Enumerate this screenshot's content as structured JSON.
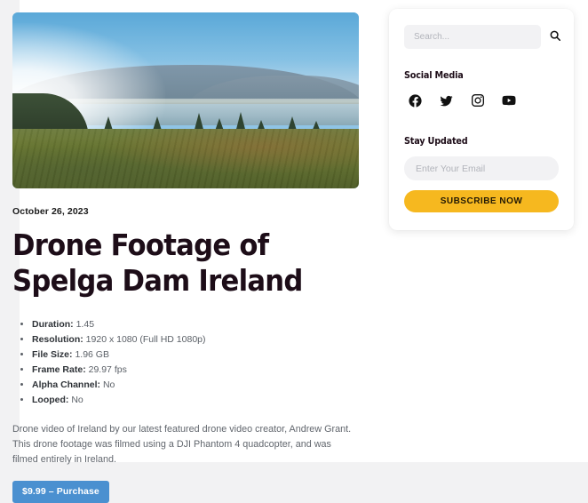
{
  "theme": {
    "page_background": "#f2f2f3",
    "card_background": "#ffffff",
    "accent_gold": "#f6b81f",
    "accent_blue": "#4a90d0",
    "heading_color": "#1d0d18",
    "body_text_color": "#61666d"
  },
  "post": {
    "hero_image_alt": "Aerial landscape of Spelga Dam, Ireland with mountain ridge, lake and grassy foreground",
    "date": "October 26, 2023",
    "title": "Drone Footage of Spelga Dam Ireland",
    "metadata": [
      {
        "label": "Duration:",
        "value": "1.45"
      },
      {
        "label": "Resolution:",
        "value": "1920 x 1080 (Full HD 1080p)"
      },
      {
        "label": "File Size:",
        "value": "1.96 GB"
      },
      {
        "label": "Frame Rate:",
        "value": "29.97 fps"
      },
      {
        "label": "Alpha Channel:",
        "value": "No"
      },
      {
        "label": "Looped:",
        "value": "No"
      }
    ],
    "description": "Drone video of Ireland by our latest featured drone video creator, Andrew Grant. This drone footage was filmed using a DJI Phantom 4 quadcopter, and was filmed entirely in Ireland.",
    "purchase_button": "$9.99 – Purchase"
  },
  "sidebar": {
    "search": {
      "value": "",
      "placeholder": "Search...",
      "icon": "search-icon"
    },
    "social": {
      "heading": "Social Media",
      "items": [
        {
          "name": "facebook",
          "icon": "facebook-icon"
        },
        {
          "name": "twitter",
          "icon": "twitter-icon"
        },
        {
          "name": "instagram",
          "icon": "instagram-icon"
        },
        {
          "name": "youtube",
          "icon": "youtube-icon"
        }
      ]
    },
    "newsletter": {
      "heading": "Stay Updated",
      "email_value": "",
      "email_placeholder": "Enter Your Email",
      "subscribe_label": "SUBSCRIBE NOW"
    }
  }
}
